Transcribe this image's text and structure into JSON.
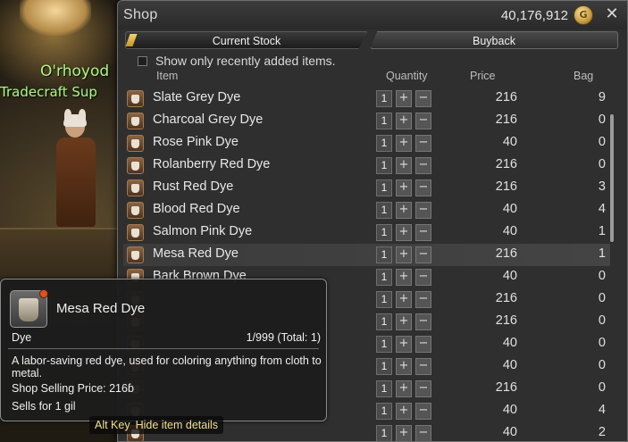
{
  "scene": {
    "npc_name": "O'rhoyod",
    "npc_title": "Tradecraft Sup"
  },
  "shop": {
    "title": "Shop",
    "gil": "40,176,912",
    "gil_icon": "gil-coin-icon",
    "close_icon": "close-icon",
    "tabs": {
      "current": "Current Stock",
      "buyback": "Buyback"
    },
    "filter_label": "Show only recently added items.",
    "filter_checked": false,
    "columns": {
      "item": "Item",
      "quantity": "Quantity",
      "price": "Price",
      "bag": "Bag"
    },
    "items": [
      {
        "name": "Slate Grey Dye",
        "qty": "1",
        "price": "216",
        "bag": "9"
      },
      {
        "name": "Charcoal Grey Dye",
        "qty": "1",
        "price": "216",
        "bag": "0"
      },
      {
        "name": "Rose Pink Dye",
        "qty": "1",
        "price": "40",
        "bag": "0"
      },
      {
        "name": "Rolanberry Red Dye",
        "qty": "1",
        "price": "216",
        "bag": "0"
      },
      {
        "name": "Rust Red Dye",
        "qty": "1",
        "price": "216",
        "bag": "3"
      },
      {
        "name": "Blood Red Dye",
        "qty": "1",
        "price": "40",
        "bag": "4"
      },
      {
        "name": "Salmon Pink Dye",
        "qty": "1",
        "price": "40",
        "bag": "1"
      },
      {
        "name": "Mesa Red Dye",
        "qty": "1",
        "price": "216",
        "bag": "1",
        "selected": true
      },
      {
        "name": "Bark Brown Dye",
        "qty": "1",
        "price": "40",
        "bag": "0"
      },
      {
        "name": "",
        "qty": "1",
        "price": "216",
        "bag": "0"
      },
      {
        "name": "",
        "qty": "1",
        "price": "216",
        "bag": "0"
      },
      {
        "name": "",
        "qty": "1",
        "price": "40",
        "bag": "0"
      },
      {
        "name": "",
        "qty": "1",
        "price": "40",
        "bag": "0"
      },
      {
        "name": "",
        "qty": "1",
        "price": "216",
        "bag": "0"
      },
      {
        "name": "",
        "qty": "1",
        "price": "40",
        "bag": "4"
      },
      {
        "name": "",
        "qty": "1",
        "price": "40",
        "bag": "2"
      }
    ]
  },
  "tooltip": {
    "name": "Mesa Red Dye",
    "category": "Dye",
    "stack": "1/999 (Total: 1)",
    "description": "A labor-saving red dye, used for coloring anything from cloth to metal.",
    "selling_price": "Shop Selling Price: 216ɓ",
    "sells_for": "Sells for 1 gil",
    "alt_key": "Alt Key",
    "alt_hint": "Hide item details"
  }
}
